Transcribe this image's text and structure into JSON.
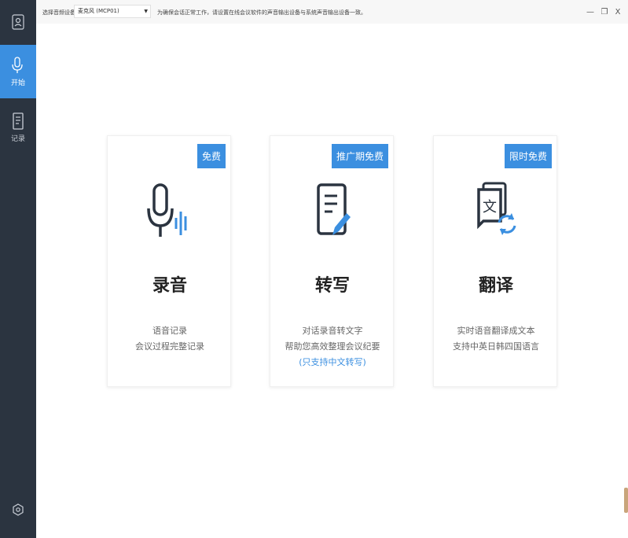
{
  "sidebar": {
    "user_icon": "user-icon",
    "items": [
      {
        "label": "开始",
        "icon": "microphone-icon",
        "active": true
      },
      {
        "label": "记录",
        "icon": "document-icon",
        "active": false
      }
    ],
    "settings_icon": "settings-icon"
  },
  "topbar": {
    "device_label": "选择音频设备",
    "device_selected": "麦克风 (MCP01)",
    "tip": "为确保会话正常工作，请设置在线会议软件的声音输出设备与系统声音输出设备一致。"
  },
  "window_controls": {
    "minimize": "—",
    "restore": "❐",
    "close": "X"
  },
  "cards": [
    {
      "badge": "免费",
      "title": "录音",
      "desc": [
        "语音记录",
        "会议过程完整记录"
      ],
      "note": ""
    },
    {
      "badge": "推广期免费",
      "title": "转写",
      "desc": [
        "对话录音转文字",
        "帮助您高效整理会议纪要"
      ],
      "note": "(只支持中文转写)"
    },
    {
      "badge": "限时免费",
      "title": "翻译",
      "desc": [
        "实时语音翻译成文本",
        "支持中英日韩四国语言"
      ],
      "note": ""
    }
  ],
  "colors": {
    "accent": "#3b8fe0",
    "sidebar": "#2b3440"
  }
}
